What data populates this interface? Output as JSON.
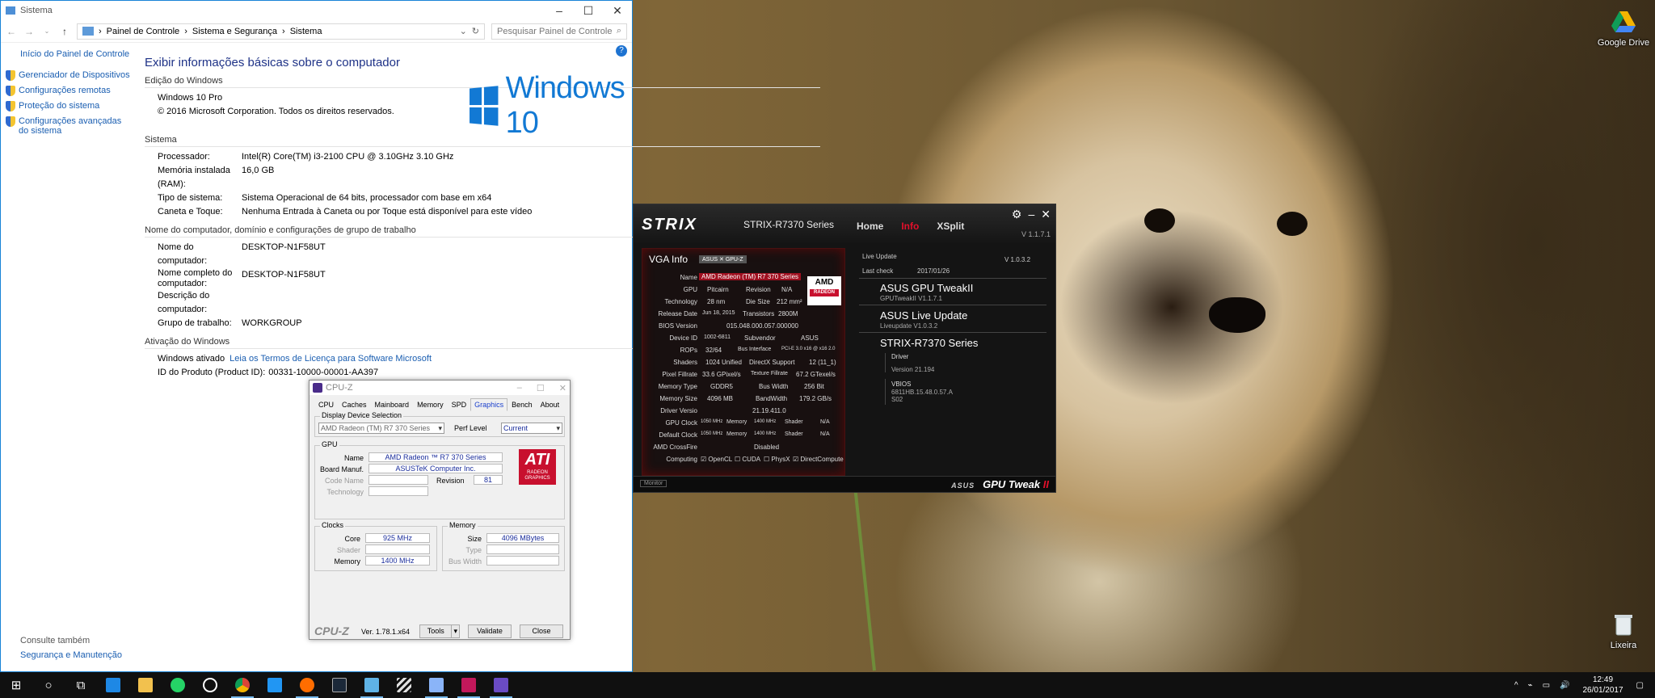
{
  "desktop": {
    "icons": [
      {
        "label": "Google Drive",
        "color": "#f4b400"
      },
      {
        "label": "Lixeira",
        "color": "#cfd8dc"
      }
    ]
  },
  "taskbar": {
    "apps": [
      {
        "name": "start",
        "glyph": "⊞",
        "color": "#ffffff"
      },
      {
        "name": "search",
        "glyph": "○",
        "color": "#ffffff"
      },
      {
        "name": "task-view",
        "glyph": "⧉",
        "color": "#ffffff"
      },
      {
        "name": "edge",
        "glyph": "e",
        "color": "#1e88e5"
      },
      {
        "name": "explorer",
        "glyph": "",
        "color": "#f2c14e"
      },
      {
        "name": "whatsapp",
        "glyph": "",
        "color": "#25d366"
      },
      {
        "name": "app-circle",
        "glyph": "◎",
        "color": "#ffffff"
      },
      {
        "name": "chrome",
        "glyph": "",
        "color": "#db4437"
      },
      {
        "name": "messenger",
        "glyph": "",
        "color": "#2196f3"
      },
      {
        "name": "app-orange",
        "glyph": "",
        "color": "#ff6d00"
      },
      {
        "name": "steam",
        "glyph": "",
        "color": "#1b2838"
      },
      {
        "name": "asus-app",
        "glyph": "",
        "color": "#5fb3e6"
      },
      {
        "name": "stripes-app",
        "glyph": "",
        "color": "#e0e0e0"
      },
      {
        "name": "monitor-app",
        "glyph": "",
        "color": "#8ab4f8"
      },
      {
        "name": "asus-red",
        "glyph": "",
        "color": "#c2185b"
      },
      {
        "name": "cpuz-app",
        "glyph": "",
        "color": "#6a4bc4"
      }
    ],
    "time": "12:49",
    "date": "26/01/2017"
  },
  "system_window": {
    "title": "Sistema",
    "breadcrumb": [
      "Painel de Controle",
      "Sistema e Segurança",
      "Sistema"
    ],
    "search_placeholder": "Pesquisar Painel de Controle",
    "left_links": [
      "Início do Painel de Controle",
      "Gerenciador de Dispositivos",
      "Configurações remotas",
      "Proteção do sistema",
      "Configurações avançadas do sistema"
    ],
    "see_also": "Consulte também",
    "see_also_link": "Segurança e Manutenção",
    "heading": "Exibir informações básicas sobre o computador",
    "edition_section": "Edição do Windows",
    "edition": "Windows 10 Pro",
    "copyright": "© 2016 Microsoft Corporation. Todos os direitos reservados.",
    "logo_text": "Windows 10",
    "system_section": "Sistema",
    "system_rows": [
      {
        "k": "Processador:",
        "v": "Intel(R) Core(TM) i3-2100 CPU @ 3.10GHz   3.10 GHz"
      },
      {
        "k": "Memória instalada (RAM):",
        "v": "16,0 GB"
      },
      {
        "k": "Tipo de sistema:",
        "v": "Sistema Operacional de 64 bits, processador com base em x64"
      },
      {
        "k": "Caneta e Toque:",
        "v": "Nenhuma Entrada à Caneta ou por Toque está disponível para este vídeo"
      }
    ],
    "computer_section": "Nome do computador, domínio e configurações de grupo de trabalho",
    "computer_rows": [
      {
        "k": "Nome do computador:",
        "v": "DESKTOP-N1F58UT"
      },
      {
        "k": "Nome completo do computador:",
        "v": "DESKTOP-N1F58UT"
      },
      {
        "k": "Descrição do computador:",
        "v": ""
      },
      {
        "k": "Grupo de trabalho:",
        "v": "WORKGROUP"
      }
    ],
    "activation_section": "Ativação do Windows",
    "activation_status": "Windows ativado",
    "activation_link": "Leia os Termos de Licença para Software Microsoft",
    "product_id_label": "ID do Produto (Product ID):",
    "product_id": "00331-10000-00001-AA397"
  },
  "cpuz": {
    "title": "CPU-Z",
    "tabs": [
      "CPU",
      "Caches",
      "Mainboard",
      "Memory",
      "SPD",
      "Graphics",
      "Bench",
      "About"
    ],
    "active_tab": "Graphics",
    "display_device_legend": "Display Device Selection",
    "device": "AMD Radeon (TM) R7 370 Series",
    "perf_level_label": "Perf Level",
    "perf_level": "Current",
    "gpu_legend": "GPU",
    "name_label": "Name",
    "name": "AMD Radeon ™ R7 370 Series",
    "board_label": "Board Manuf.",
    "board": "ASUSTeK Computer Inc.",
    "code_name_label": "Code Name",
    "technology_label": "Technology",
    "revision_label": "Revision",
    "revision": "81",
    "clocks_legend": "Clocks",
    "core_label": "Core",
    "core": "925 MHz",
    "shader_label": "Shader",
    "memory_label": "Memory",
    "memory_clock": "1400 MHz",
    "memory_legend": "Memory",
    "size_label": "Size",
    "size": "4096 MBytes",
    "type_label": "Type",
    "bus_width_label": "Bus Width",
    "brand": "CPU-Z",
    "version": "Ver. 1.78.1.x64",
    "tools": "Tools",
    "validate": "Validate",
    "close": "Close",
    "ati_text": "ATI",
    "ati_sub": "RADEON",
    "ati_sub2": "GRAPHICS"
  },
  "gpu_tweak": {
    "logo": "STRIX",
    "model": "STRIX-R7370 Series",
    "nav": [
      "Home",
      "Info",
      "XSplit"
    ],
    "active_nav": "Info",
    "app_version": "V 1.1.7.1",
    "vga_title": "VGA Info",
    "gpuz_badge": "ASUS ✕ GPU-Z",
    "rows": {
      "name_l": "Name",
      "name_v": "AMD Radeon (TM) R7 370 Series",
      "gpu_l": "GPU",
      "gpu_v": "Pitcairn",
      "revision_l": "Revision",
      "revision_v": "N/A",
      "tech_l": "Technology",
      "tech_v": "28 nm",
      "die_l": "Die Size",
      "die_v": "212 mm²",
      "release_l": "Release Date",
      "release_v": "Jun 18, 2015",
      "trans_l": "Transistors",
      "trans_v": "2800M",
      "bios_l": "BIOS Version",
      "bios_v": "015.048.000.057.000000",
      "devid_l": "Device ID",
      "devid_v": "1002-6811",
      "subv_l": "Subvendor",
      "subv_v": "ASUS",
      "rops_l": "ROPs",
      "rops_v": "32/64",
      "bus_l": "Bus Interface",
      "bus_v": "PCI-E 3.0 x16 @ x16 2.0",
      "shaders_l": "Shaders",
      "shaders_v": "1024 Unified",
      "dx_l": "DirectX Support",
      "dx_v": "12 (11_1)",
      "pf_l": "Pixel Fillrate",
      "pf_v": "33.6 GPixel/s",
      "tf_l": "Texture Fillrate",
      "tf_v": "67.2 GTexel/s",
      "mt_l": "Memory Type",
      "mt_v": "GDDR5",
      "bw_l": "Bus Width",
      "bw_v": "256 Bit",
      "ms_l": "Memory Size",
      "ms_v": "4096 MB",
      "band_l": "BandWidth",
      "band_v": "179.2 GB/s",
      "drv_l": "Driver Versio",
      "drv_v": "21.19.411.0",
      "gclk_l": "GPU Clock",
      "gclk_v": "1050 MHz",
      "gmem_l": "Memory",
      "gmem_v": "1400 MHz",
      "gsh_l": "Shader",
      "gsh_v": "N/A",
      "dclk_l": "Default Clock",
      "dclk_v": "1050 MHz",
      "dmem_l": "Memory",
      "dmem_v": "1400 MHz",
      "dsh_l": "Shader",
      "dsh_v": "N/A",
      "cf_l": "AMD CrossFire",
      "cf_v": "Disabled",
      "comp_l": "Computing",
      "opencl": "OpenCL",
      "cuda": "CUDA",
      "physx": "PhysX",
      "dcomp": "DirectCompute"
    },
    "amd": "AMD",
    "amd_sub": "RADEON",
    "live_update": "Live Update",
    "live_version": "V 1.0.3.2",
    "last_check_label": "Last check",
    "last_check": "2017/01/26",
    "items": [
      {
        "title": "ASUS GPU TweakII",
        "sub": "GPUTweakII V1.1.7.1"
      },
      {
        "title": "ASUS Live Update",
        "sub": "Liveupdate V1.0.3.2"
      },
      {
        "title": "STRIX-R7370 Series",
        "sub": ""
      }
    ],
    "driver_label": "Driver",
    "driver_version": "Version 21.194",
    "vbios_label": "VBIOS",
    "vbios_version": "6811HB.15.48.0.57.A",
    "vbios_code": "S02",
    "monitor": "Monitor",
    "asus": "ASUS",
    "brand": "GPU Tweak",
    "brand_ii": "II"
  }
}
